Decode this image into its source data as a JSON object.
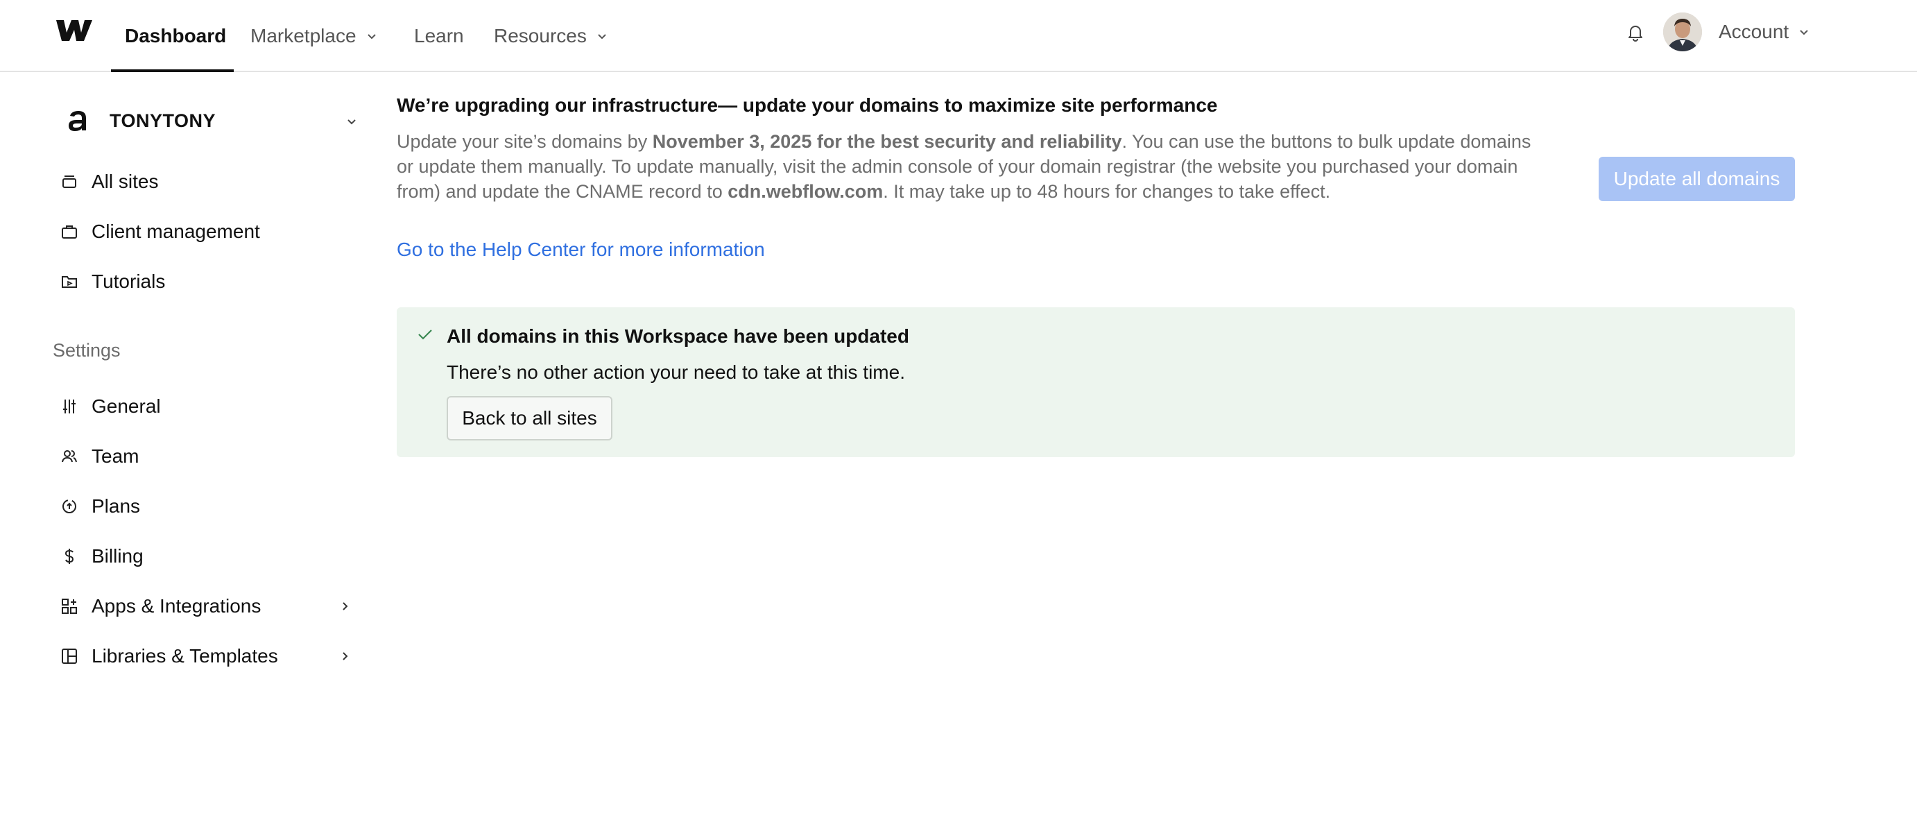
{
  "nav": {
    "logo": "webflow-logo",
    "items": [
      {
        "label": "Dashboard",
        "active": true
      },
      {
        "label": "Marketplace",
        "has_dropdown": true
      },
      {
        "label": "Learn"
      },
      {
        "label": "Resources",
        "has_dropdown": true
      }
    ],
    "account_label": "Account"
  },
  "sidebar": {
    "workspace_name": "TONYTONY",
    "items": [
      {
        "label": "All sites",
        "icon": "sites-icon"
      },
      {
        "label": "Client management",
        "icon": "briefcase-icon"
      },
      {
        "label": "Tutorials",
        "icon": "tutorials-icon"
      }
    ],
    "settings_label": "Settings",
    "settings_items": [
      {
        "label": "General",
        "icon": "sliders-icon"
      },
      {
        "label": "Team",
        "icon": "team-icon"
      },
      {
        "label": "Plans",
        "icon": "plans-icon"
      },
      {
        "label": "Billing",
        "icon": "dollar-icon"
      },
      {
        "label": "Apps & Integrations",
        "icon": "apps-icon",
        "has_submenu": true
      },
      {
        "label": "Libraries & Templates",
        "icon": "libraries-icon",
        "has_submenu": true
      }
    ]
  },
  "main": {
    "headline": "We’re upgrading our infrastructure— update your domains to maximize site performance",
    "para_1": "Update your site’s domains by ",
    "para_bold_1": "November 3, 2025 for the best security and reliability",
    "para_2": ". You can use the buttons to bulk update domains or update them manually. To update manually, visit the admin console of your domain registrar (the website you purchased your domain from) and update the CNAME record to ",
    "para_bold_2": "cdn.webflow.com",
    "para_3": ". It may take up to 48 hours for changes to take effect.",
    "help_link": "Go to the Help Center for more information",
    "update_button": "Update all domains",
    "success": {
      "title": "All domains in this Workspace have been updated",
      "text": "There’s no other action your need to take at this time.",
      "back_button": "Back to all sites"
    }
  },
  "colors": {
    "link": "#2f6fe0",
    "disabled_button": "#a9c3f5",
    "success_bg": "#edf5ee",
    "success_check": "#3d8a55"
  }
}
